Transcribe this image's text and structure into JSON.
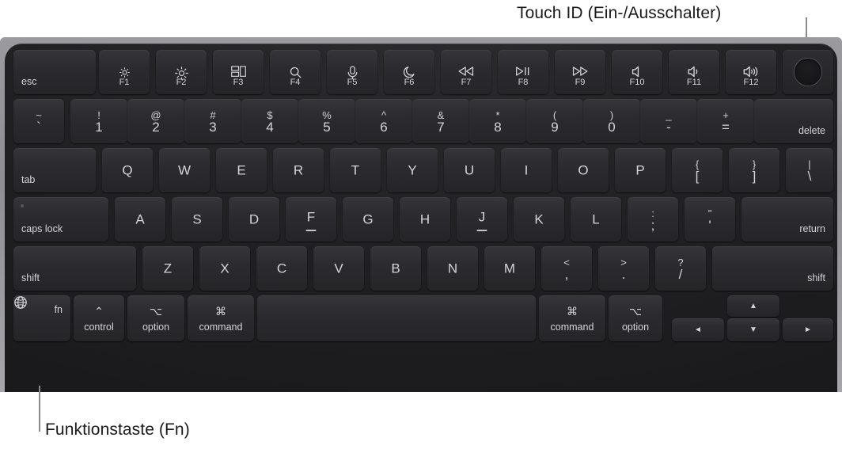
{
  "callouts": {
    "touch_id": "Touch ID (Ein-/Ausschalter)",
    "fn": "Funktionstaste (Fn)"
  },
  "colors": {
    "page_background": "#ffffff",
    "enclosure": "#8e8e93",
    "keyboard_body": "#202023",
    "key_face": "#2c2c30",
    "key_legend": "#d4d4d6",
    "callout_text": "#1a1a1a",
    "leader_line": "#8a8a8a"
  },
  "keyboard": {
    "rows": {
      "function_row": [
        {
          "name": "esc",
          "label": "esc",
          "style": "bottom-left"
        },
        {
          "name": "f1",
          "icon": "brightness-down-icon",
          "fnum": "F1"
        },
        {
          "name": "f2",
          "icon": "brightness-up-icon",
          "fnum": "F2"
        },
        {
          "name": "f3",
          "icon": "mission-control-icon",
          "fnum": "F3"
        },
        {
          "name": "f4",
          "icon": "spotlight-search-icon",
          "fnum": "F4"
        },
        {
          "name": "f5",
          "icon": "dictation-mic-icon",
          "fnum": "F5"
        },
        {
          "name": "f6",
          "icon": "do-not-disturb-moon-icon",
          "fnum": "F6"
        },
        {
          "name": "f7",
          "icon": "rewind-icon",
          "fnum": "F7"
        },
        {
          "name": "f8",
          "icon": "play-pause-icon",
          "fnum": "F8"
        },
        {
          "name": "f9",
          "icon": "fast-forward-icon",
          "fnum": "F9"
        },
        {
          "name": "f10",
          "icon": "mute-icon",
          "fnum": "F10"
        },
        {
          "name": "f11",
          "icon": "volume-down-icon",
          "fnum": "F11"
        },
        {
          "name": "f12",
          "icon": "volume-up-icon",
          "fnum": "F12"
        },
        {
          "name": "touch-id",
          "icon": "touch-id-icon"
        }
      ],
      "number_row": [
        {
          "name": "grave",
          "upper": "~",
          "lower": "`"
        },
        {
          "name": "1",
          "upper": "!",
          "lower": "1"
        },
        {
          "name": "2",
          "upper": "@",
          "lower": "2"
        },
        {
          "name": "3",
          "upper": "#",
          "lower": "3"
        },
        {
          "name": "4",
          "upper": "$",
          "lower": "4"
        },
        {
          "name": "5",
          "upper": "%",
          "lower": "5"
        },
        {
          "name": "6",
          "upper": "^",
          "lower": "6"
        },
        {
          "name": "7",
          "upper": "&",
          "lower": "7"
        },
        {
          "name": "8",
          "upper": "*",
          "lower": "8"
        },
        {
          "name": "9",
          "upper": "(",
          "lower": "9"
        },
        {
          "name": "0",
          "upper": ")",
          "lower": "0"
        },
        {
          "name": "minus",
          "upper": "_",
          "lower": "-"
        },
        {
          "name": "equal",
          "upper": "+",
          "lower": "="
        },
        {
          "name": "delete",
          "label": "delete",
          "style": "bottom-right"
        }
      ],
      "top_letter_row": [
        {
          "name": "tab",
          "label": "tab",
          "style": "bottom-left"
        },
        {
          "name": "q",
          "glyph": "Q"
        },
        {
          "name": "w",
          "glyph": "W"
        },
        {
          "name": "e",
          "glyph": "E"
        },
        {
          "name": "r",
          "glyph": "R"
        },
        {
          "name": "t",
          "glyph": "T"
        },
        {
          "name": "y",
          "glyph": "Y"
        },
        {
          "name": "u",
          "glyph": "U"
        },
        {
          "name": "i",
          "glyph": "I"
        },
        {
          "name": "o",
          "glyph": "O"
        },
        {
          "name": "p",
          "glyph": "P"
        },
        {
          "name": "bracket-left",
          "upper": "{",
          "lower": "["
        },
        {
          "name": "bracket-right",
          "upper": "}",
          "lower": "]"
        },
        {
          "name": "backslash",
          "upper": "|",
          "lower": "\\"
        }
      ],
      "home_row": [
        {
          "name": "caps-lock",
          "label": "caps lock",
          "style": "bottom-left",
          "indicator": true
        },
        {
          "name": "a",
          "glyph": "A"
        },
        {
          "name": "s",
          "glyph": "S"
        },
        {
          "name": "d",
          "glyph": "D"
        },
        {
          "name": "f",
          "glyph": "F",
          "homing": true
        },
        {
          "name": "g",
          "glyph": "G"
        },
        {
          "name": "h",
          "glyph": "H"
        },
        {
          "name": "j",
          "glyph": "J",
          "homing": true
        },
        {
          "name": "k",
          "glyph": "K"
        },
        {
          "name": "l",
          "glyph": "L"
        },
        {
          "name": "semicolon",
          "upper": ":",
          "lower": ";"
        },
        {
          "name": "quote",
          "upper": "\"",
          "lower": "'"
        },
        {
          "name": "return",
          "label": "return",
          "style": "bottom-right"
        }
      ],
      "shift_row": [
        {
          "name": "shift-left",
          "label": "shift",
          "style": "bottom-left"
        },
        {
          "name": "z",
          "glyph": "Z"
        },
        {
          "name": "x",
          "glyph": "X"
        },
        {
          "name": "c",
          "glyph": "C"
        },
        {
          "name": "v",
          "glyph": "V"
        },
        {
          "name": "b",
          "glyph": "B"
        },
        {
          "name": "n",
          "glyph": "N"
        },
        {
          "name": "m",
          "glyph": "M"
        },
        {
          "name": "comma",
          "upper": "<",
          "lower": ","
        },
        {
          "name": "period",
          "upper": ">",
          "lower": "."
        },
        {
          "name": "slash",
          "upper": "?",
          "lower": "/"
        },
        {
          "name": "shift-right",
          "label": "shift",
          "style": "bottom-right"
        }
      ],
      "bottom_row": [
        {
          "name": "fn",
          "label": "fn",
          "icon": "globe-icon"
        },
        {
          "name": "control",
          "symbol": "⌃",
          "word": "control"
        },
        {
          "name": "option-left",
          "symbol": "⌥",
          "word": "option"
        },
        {
          "name": "command-left",
          "symbol": "⌘",
          "word": "command"
        },
        {
          "name": "space",
          "label": ""
        },
        {
          "name": "command-right",
          "symbol": "⌘",
          "word": "command"
        },
        {
          "name": "option-right",
          "symbol": "⌥",
          "word": "option"
        },
        {
          "name": "arrow-left",
          "icon": "arrow-left-icon"
        },
        {
          "name": "arrow-up",
          "icon": "arrow-up-icon"
        },
        {
          "name": "arrow-down",
          "icon": "arrow-down-icon"
        },
        {
          "name": "arrow-right",
          "icon": "arrow-right-icon"
        }
      ]
    }
  }
}
